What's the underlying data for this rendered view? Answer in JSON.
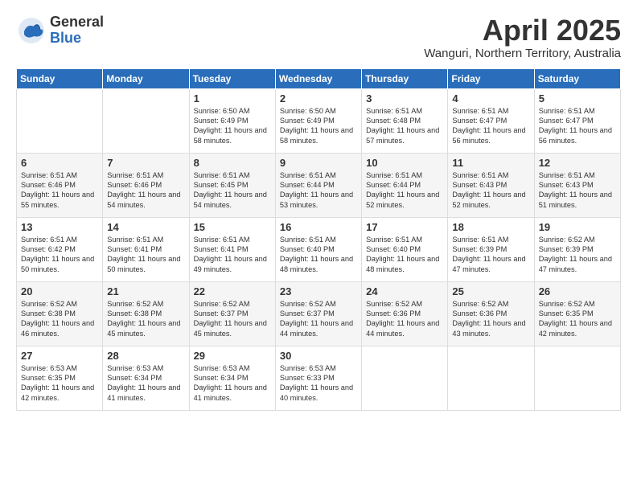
{
  "logo": {
    "general": "General",
    "blue": "Blue"
  },
  "title": "April 2025",
  "subtitle": "Wanguri, Northern Territory, Australia",
  "days_of_week": [
    "Sunday",
    "Monday",
    "Tuesday",
    "Wednesday",
    "Thursday",
    "Friday",
    "Saturday"
  ],
  "weeks": [
    [
      {
        "day": "",
        "info": ""
      },
      {
        "day": "",
        "info": ""
      },
      {
        "day": "1",
        "info": "Sunrise: 6:50 AM\nSunset: 6:49 PM\nDaylight: 11 hours and 58 minutes."
      },
      {
        "day": "2",
        "info": "Sunrise: 6:50 AM\nSunset: 6:49 PM\nDaylight: 11 hours and 58 minutes."
      },
      {
        "day": "3",
        "info": "Sunrise: 6:51 AM\nSunset: 6:48 PM\nDaylight: 11 hours and 57 minutes."
      },
      {
        "day": "4",
        "info": "Sunrise: 6:51 AM\nSunset: 6:47 PM\nDaylight: 11 hours and 56 minutes."
      },
      {
        "day": "5",
        "info": "Sunrise: 6:51 AM\nSunset: 6:47 PM\nDaylight: 11 hours and 56 minutes."
      }
    ],
    [
      {
        "day": "6",
        "info": "Sunrise: 6:51 AM\nSunset: 6:46 PM\nDaylight: 11 hours and 55 minutes."
      },
      {
        "day": "7",
        "info": "Sunrise: 6:51 AM\nSunset: 6:46 PM\nDaylight: 11 hours and 54 minutes."
      },
      {
        "day": "8",
        "info": "Sunrise: 6:51 AM\nSunset: 6:45 PM\nDaylight: 11 hours and 54 minutes."
      },
      {
        "day": "9",
        "info": "Sunrise: 6:51 AM\nSunset: 6:44 PM\nDaylight: 11 hours and 53 minutes."
      },
      {
        "day": "10",
        "info": "Sunrise: 6:51 AM\nSunset: 6:44 PM\nDaylight: 11 hours and 52 minutes."
      },
      {
        "day": "11",
        "info": "Sunrise: 6:51 AM\nSunset: 6:43 PM\nDaylight: 11 hours and 52 minutes."
      },
      {
        "day": "12",
        "info": "Sunrise: 6:51 AM\nSunset: 6:43 PM\nDaylight: 11 hours and 51 minutes."
      }
    ],
    [
      {
        "day": "13",
        "info": "Sunrise: 6:51 AM\nSunset: 6:42 PM\nDaylight: 11 hours and 50 minutes."
      },
      {
        "day": "14",
        "info": "Sunrise: 6:51 AM\nSunset: 6:41 PM\nDaylight: 11 hours and 50 minutes."
      },
      {
        "day": "15",
        "info": "Sunrise: 6:51 AM\nSunset: 6:41 PM\nDaylight: 11 hours and 49 minutes."
      },
      {
        "day": "16",
        "info": "Sunrise: 6:51 AM\nSunset: 6:40 PM\nDaylight: 11 hours and 48 minutes."
      },
      {
        "day": "17",
        "info": "Sunrise: 6:51 AM\nSunset: 6:40 PM\nDaylight: 11 hours and 48 minutes."
      },
      {
        "day": "18",
        "info": "Sunrise: 6:51 AM\nSunset: 6:39 PM\nDaylight: 11 hours and 47 minutes."
      },
      {
        "day": "19",
        "info": "Sunrise: 6:52 AM\nSunset: 6:39 PM\nDaylight: 11 hours and 47 minutes."
      }
    ],
    [
      {
        "day": "20",
        "info": "Sunrise: 6:52 AM\nSunset: 6:38 PM\nDaylight: 11 hours and 46 minutes."
      },
      {
        "day": "21",
        "info": "Sunrise: 6:52 AM\nSunset: 6:38 PM\nDaylight: 11 hours and 45 minutes."
      },
      {
        "day": "22",
        "info": "Sunrise: 6:52 AM\nSunset: 6:37 PM\nDaylight: 11 hours and 45 minutes."
      },
      {
        "day": "23",
        "info": "Sunrise: 6:52 AM\nSunset: 6:37 PM\nDaylight: 11 hours and 44 minutes."
      },
      {
        "day": "24",
        "info": "Sunrise: 6:52 AM\nSunset: 6:36 PM\nDaylight: 11 hours and 44 minutes."
      },
      {
        "day": "25",
        "info": "Sunrise: 6:52 AM\nSunset: 6:36 PM\nDaylight: 11 hours and 43 minutes."
      },
      {
        "day": "26",
        "info": "Sunrise: 6:52 AM\nSunset: 6:35 PM\nDaylight: 11 hours and 42 minutes."
      }
    ],
    [
      {
        "day": "27",
        "info": "Sunrise: 6:53 AM\nSunset: 6:35 PM\nDaylight: 11 hours and 42 minutes."
      },
      {
        "day": "28",
        "info": "Sunrise: 6:53 AM\nSunset: 6:34 PM\nDaylight: 11 hours and 41 minutes."
      },
      {
        "day": "29",
        "info": "Sunrise: 6:53 AM\nSunset: 6:34 PM\nDaylight: 11 hours and 41 minutes."
      },
      {
        "day": "30",
        "info": "Sunrise: 6:53 AM\nSunset: 6:33 PM\nDaylight: 11 hours and 40 minutes."
      },
      {
        "day": "",
        "info": ""
      },
      {
        "day": "",
        "info": ""
      },
      {
        "day": "",
        "info": ""
      }
    ]
  ]
}
